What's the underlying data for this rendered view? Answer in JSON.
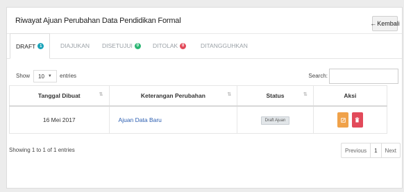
{
  "panel": {
    "title": "Riwayat Ajuan Perubahan Data Pendidikan Formal",
    "back_label": "Kembali",
    "back_arrow": "←"
  },
  "tabs": [
    {
      "label": "DRAFT",
      "badge": "1",
      "badge_color": "#17a2b8"
    },
    {
      "label": "DIAJUKAN"
    },
    {
      "label": "DISETUJUI",
      "badge": "0",
      "badge_color": "#2bb673"
    },
    {
      "label": "DITOLAK",
      "badge": "0",
      "badge_color": "#e24a5a"
    },
    {
      "label": "DITANGGUHKAN"
    }
  ],
  "controls": {
    "show_label": "Show",
    "entries_value": "10",
    "entries_label": "entries",
    "search_label": "Search:"
  },
  "table": {
    "columns": [
      "Tanggal Dibuat",
      "Keterangan Perubahan",
      "Status",
      "Aksi"
    ],
    "rows": [
      {
        "date": "16 Mei 2017",
        "desc": "Ajuan Data Baru",
        "status": "Draft Ajuan"
      }
    ]
  },
  "footer": {
    "info": "Showing 1 to 1 of 1 entries",
    "prev": "Previous",
    "page": "1",
    "next": "Next"
  },
  "colors": {
    "edit_button": "#f0a24a",
    "delete_button": "#e24a5a",
    "link": "#2a5db0"
  }
}
